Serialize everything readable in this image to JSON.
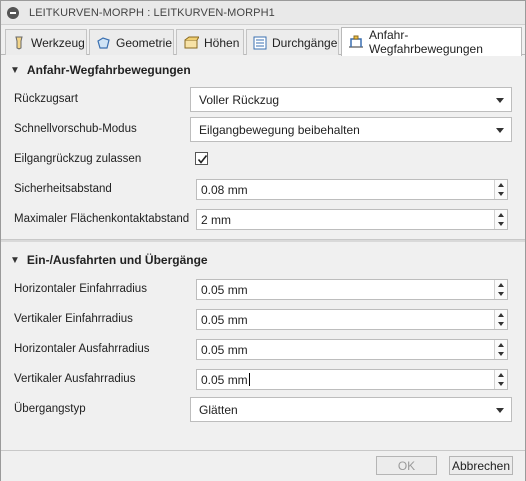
{
  "window": {
    "title": "LEITKURVEN-MORPH : LEITKURVEN-MORPH1"
  },
  "tabs": [
    {
      "label": "Werkzeug",
      "icon": "tool-icon"
    },
    {
      "label": "Geometrie",
      "icon": "geometry-icon"
    },
    {
      "label": "Höhen",
      "icon": "heights-icon"
    },
    {
      "label": "Durchgänge",
      "icon": "passes-icon"
    },
    {
      "label": "Anfahr-Wegfahrbewegungen",
      "icon": "linking-icon",
      "active": true
    }
  ],
  "section1": {
    "title": "Anfahr-Wegfahrbewegungen",
    "retract_type": {
      "label": "Rückzugsart",
      "value": "Voller Rückzug"
    },
    "rapid_mode": {
      "label": "Schnellvorschub-Modus",
      "value": "Eilgangbewegung beibehalten"
    },
    "allow_rapid_retract": {
      "label": "Eilgangrückzug zulassen",
      "checked": true
    },
    "safe_distance": {
      "label": "Sicherheitsabstand",
      "value": "0.08 mm"
    },
    "max_stay_down": {
      "label": "Maximaler Flächenkontaktabstand",
      "value": "2 mm"
    }
  },
  "section2": {
    "title": "Ein-/Ausfahrten und Übergänge",
    "h_entry_radius": {
      "label": "Horizontaler Einfahrradius",
      "value": "0.05 mm"
    },
    "v_entry_radius": {
      "label": "Vertikaler Einfahrradius",
      "value": "0.05 mm"
    },
    "h_exit_radius": {
      "label": "Horizontaler Ausfahrradius",
      "value": "0.05 mm"
    },
    "v_exit_radius": {
      "label": "Vertikaler Ausfahrradius",
      "value": "0.05 mm"
    },
    "transition_type": {
      "label": "Übergangstyp",
      "value": "Glätten"
    }
  },
  "footer": {
    "ok": "OK",
    "cancel": "Abbrechen"
  }
}
